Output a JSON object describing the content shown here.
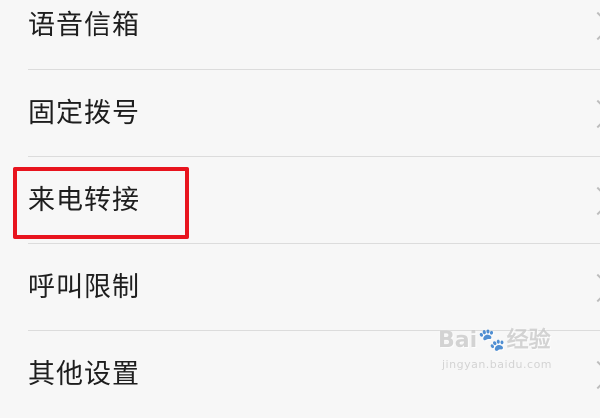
{
  "settings_list": {
    "items": [
      {
        "label": "语音信箱"
      },
      {
        "label": "固定拨号"
      },
      {
        "label": "来电转接"
      },
      {
        "label": "呼叫限制"
      },
      {
        "label": "其他设置"
      }
    ],
    "highlighted_item": "来电转接",
    "highlight_color": "#e8141e",
    "chevron_icon": "chevron-right-icon"
  },
  "watermark": {
    "brand_left": "Bai",
    "brand_icon": "paw-icon",
    "brand_right": "经验",
    "site": "jingyan.baidu.com"
  }
}
